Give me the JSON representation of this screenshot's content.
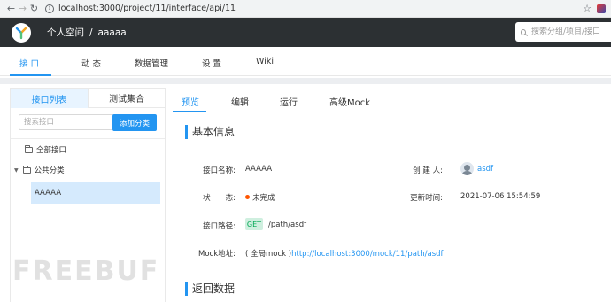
{
  "browser": {
    "url": "localhost:3000/project/11/interface/api/11"
  },
  "header": {
    "breadcrumb_space": "个人空间",
    "breadcrumb_sep": "/",
    "breadcrumb_project": "aaaaa",
    "search_placeholder": "搜索分组/项目/接口"
  },
  "main_tabs": [
    {
      "label": "接 口",
      "active": true
    },
    {
      "label": "动 态",
      "active": false
    },
    {
      "label": "数据管理",
      "active": false
    },
    {
      "label": "设 置",
      "active": false
    },
    {
      "label": "Wiki",
      "active": false
    }
  ],
  "sidebar": {
    "tabs": [
      {
        "label": "接口列表",
        "active": true
      },
      {
        "label": "测试集合",
        "active": false
      }
    ],
    "search_placeholder": "搜索接口",
    "add_button": "添加分类",
    "tree": {
      "all": "全部接口",
      "category": "公共分类",
      "selected_item": "AAAAA"
    }
  },
  "detail_tabs": [
    {
      "label": "预览",
      "active": true
    },
    {
      "label": "编辑",
      "active": false
    },
    {
      "label": "运行",
      "active": false
    },
    {
      "label": "高级Mock",
      "active": false
    }
  ],
  "basic_info": {
    "title": "基本信息",
    "name_label": "接口名称:",
    "name_value": "AAAAA",
    "creator_label": "创 建 人:",
    "creator_value": "asdf",
    "status_label": "状　　态:",
    "status_value": "未完成",
    "status_color": "#ff5500",
    "updated_label": "更新时间:",
    "updated_value": "2021-07-06 15:54:59",
    "path_label": "接口路径:",
    "method": "GET",
    "path_value": "/path/asdf",
    "mock_label": "Mock地址:",
    "mock_prefix": "( 全局mock )",
    "mock_url": "http://localhost:3000/mock/11/path/asdf"
  },
  "return_data": {
    "title": "返回数据"
  },
  "watermark": "FREEBUF",
  "colors": {
    "accent": "#2395f1",
    "header_bg": "#2c3033",
    "get_badge_bg": "#cfefdf",
    "get_badge_text": "#00a854"
  }
}
